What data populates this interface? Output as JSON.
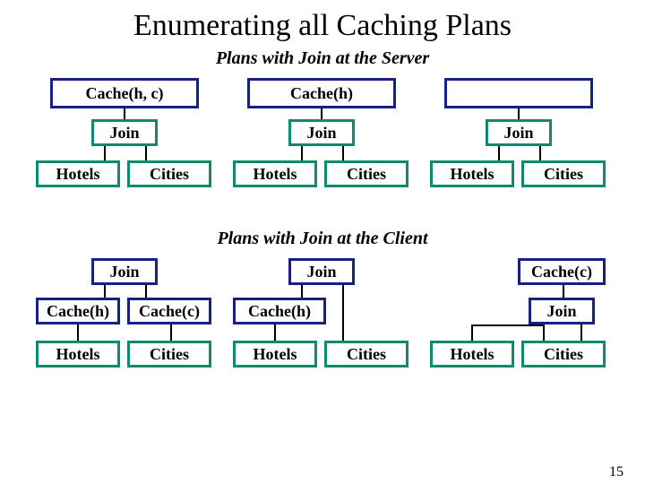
{
  "title": "Enumerating all Caching Plans",
  "subtitle1": "Plans with Join at the Server",
  "subtitle2": "Plans with Join at the Client",
  "pagenum": "15",
  "labels": {
    "cache_hc": "Cache(h, c)",
    "cache_h": "Cache(h)",
    "cache_c": "Cache(c)",
    "join": "Join",
    "hotels": "Hotels",
    "cities": "Cities"
  }
}
